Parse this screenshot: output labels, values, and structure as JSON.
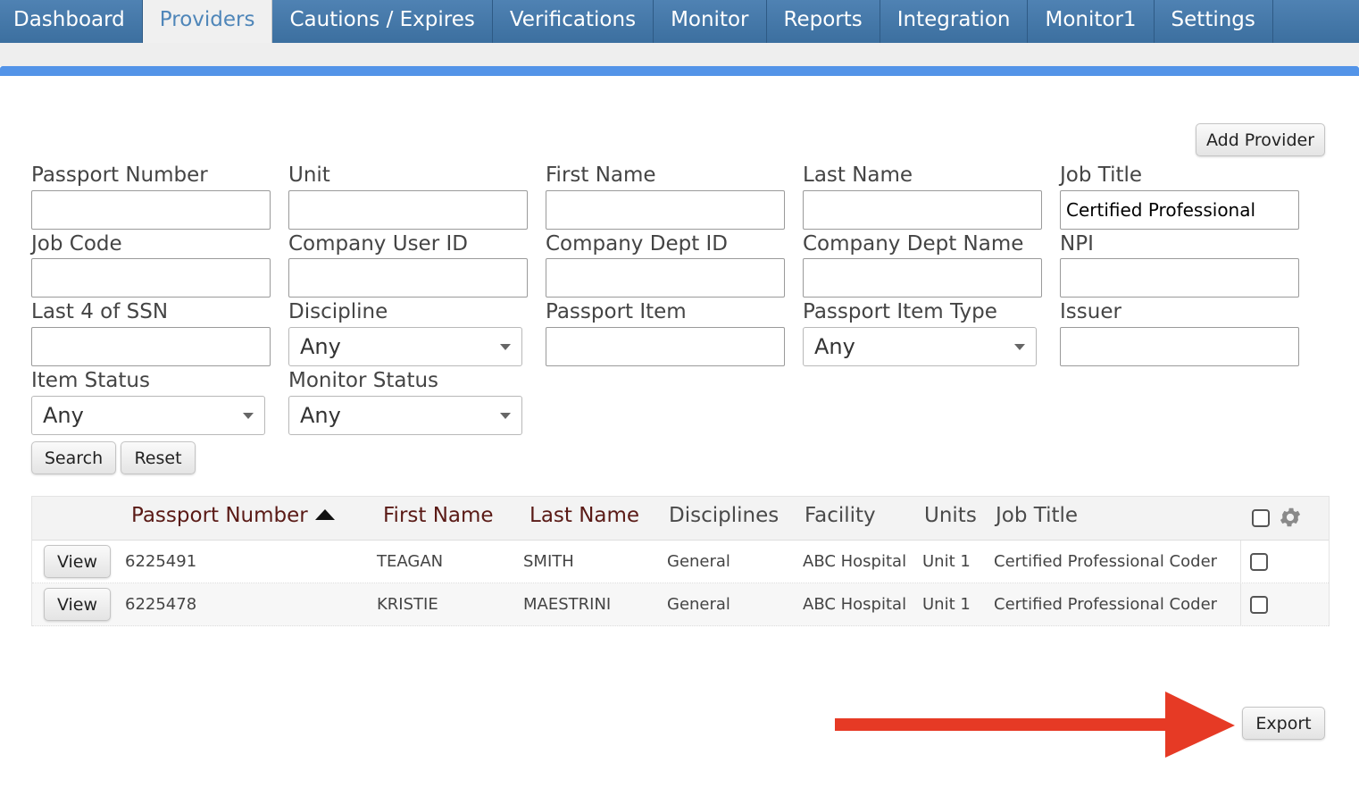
{
  "nav": {
    "tabs": [
      {
        "label": "Dashboard"
      },
      {
        "label": "Providers"
      },
      {
        "label": "Cautions / Expires"
      },
      {
        "label": "Verifications"
      },
      {
        "label": "Monitor"
      },
      {
        "label": "Reports"
      },
      {
        "label": "Integration"
      },
      {
        "label": "Monitor1"
      },
      {
        "label": "Settings"
      }
    ],
    "active_tab": "Providers"
  },
  "actions": {
    "add_provider": "Add Provider",
    "search": "Search",
    "reset": "Reset",
    "export": "Export"
  },
  "form": {
    "passport_number": {
      "label": "Passport Number",
      "value": ""
    },
    "unit": {
      "label": "Unit",
      "value": ""
    },
    "first_name": {
      "label": "First Name",
      "value": ""
    },
    "last_name": {
      "label": "Last Name",
      "value": ""
    },
    "job_title": {
      "label": "Job Title",
      "value": "Certified Professional"
    },
    "job_code": {
      "label": "Job Code",
      "value": ""
    },
    "company_user_id": {
      "label": "Company User ID",
      "value": ""
    },
    "company_dept_id": {
      "label": "Company Dept ID",
      "value": ""
    },
    "company_dept_name": {
      "label": "Company Dept Name",
      "value": ""
    },
    "npi": {
      "label": "NPI",
      "value": ""
    },
    "last4_ssn": {
      "label": "Last 4 of SSN",
      "value": ""
    },
    "discipline": {
      "label": "Discipline",
      "value": "Any"
    },
    "passport_item": {
      "label": "Passport Item",
      "value": ""
    },
    "passport_item_type": {
      "label": "Passport Item Type",
      "value": "Any"
    },
    "issuer": {
      "label": "Issuer",
      "value": ""
    },
    "item_status": {
      "label": "Item Status",
      "value": "Any"
    },
    "monitor_status": {
      "label": "Monitor Status",
      "value": "Any"
    }
  },
  "table": {
    "columns": {
      "passport_number": "Passport Number",
      "first_name": "First Name",
      "last_name": "Last Name",
      "disciplines": "Disciplines",
      "facility": "Facility",
      "units": "Units",
      "job_title": "Job Title"
    },
    "sort_column": "Passport Number",
    "sort_direction": "ascending",
    "rows": [
      {
        "view_label": "View",
        "passport_number": "6225491",
        "first_name": "TEAGAN",
        "last_name": "SMITH",
        "disciplines": "General",
        "facility": "ABC Hospital",
        "units": "Unit 1",
        "job_title": "Certified Professional Coder",
        "checked": false
      },
      {
        "view_label": "View",
        "passport_number": "6225478",
        "first_name": "KRISTIE",
        "last_name": "MAESTRINI",
        "disciplines": "General",
        "facility": "ABC Hospital",
        "units": "Unit 1",
        "job_title": "Certified Professional Coder",
        "checked": false
      }
    ]
  },
  "colors": {
    "nav_bg": "#4a7dae",
    "accent_bar": "#5394e8",
    "active_tab_text": "#4f86b9",
    "sorted_header": "#5a1a16",
    "annotation_arrow": "#e63a25"
  }
}
